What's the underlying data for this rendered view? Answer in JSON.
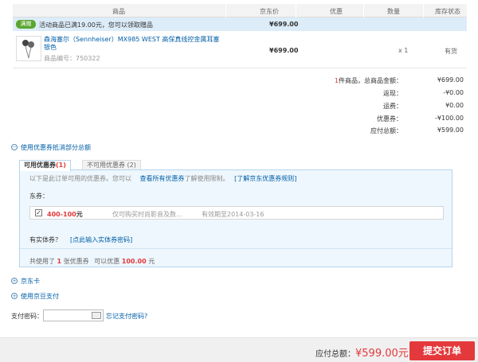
{
  "table_header": {
    "columns": [
      "商品",
      "京东价",
      "优惠",
      "数量",
      "库存状态"
    ]
  },
  "promo": {
    "badge": "满赠",
    "text": "活动商品已满19.00元，您可以领取赠品",
    "price": "¥699.00"
  },
  "product": {
    "name": "森海塞尔（Sennheiser）MX985 WEST 高保真线控金属耳塞 银色",
    "sku": "商品编号：750322",
    "price": "¥699.00",
    "qty": "x 1",
    "stock": "有货"
  },
  "summary": {
    "count": "1",
    "rows": [
      {
        "label": "件商品，总商品金额：",
        "value": "¥699.00"
      },
      {
        "label": "返现：",
        "value": "-¥0.00"
      },
      {
        "label": "运费：",
        "value": "¥0.00"
      },
      {
        "label": "优惠券：",
        "value": "-¥100.00"
      },
      {
        "label": "应付总额：",
        "value": "¥599.00"
      }
    ]
  },
  "coupon": {
    "section_title": "使用优惠券抵消部分总额",
    "toggle_minus": "−",
    "tab_available_text": "可用优惠券",
    "tab_available_count": "(1)",
    "tab_unavailable": "不可用优惠券 (2)",
    "hint_pre": "以下是此订单可用的优惠券。您可以",
    "hint_link": "查看所有优惠券",
    "hint_post": "了解使用限制。",
    "hint_link2": "[了解京东优惠券规则]",
    "dongquan_label": "东券：",
    "item": {
      "checked": "✓",
      "title": "400-100",
      "unit": "元",
      "desc": "仅可购买时尚影音及数...",
      "validity": "有效期至2014-03-16"
    },
    "physical_label": "有实体券？",
    "physical_link": "[点此输入实体券密码]",
    "used_pre": "共使用了",
    "used_count": "1",
    "used_mid": "张优惠券",
    "used_mid2": "可以优惠",
    "used_amount": "100.00",
    "used_unit": "元"
  },
  "jd_card": {
    "label": "京东卡",
    "toggle": "+"
  },
  "jd_bean": {
    "label": "使用京豆支付",
    "toggle": "+"
  },
  "password": {
    "label": "支付密码：",
    "placeholder": "",
    "forgot": "忘记支付密码?"
  },
  "footer": {
    "label": "应付总额：",
    "amount": "¥599.00元",
    "submit": "提交订单"
  }
}
